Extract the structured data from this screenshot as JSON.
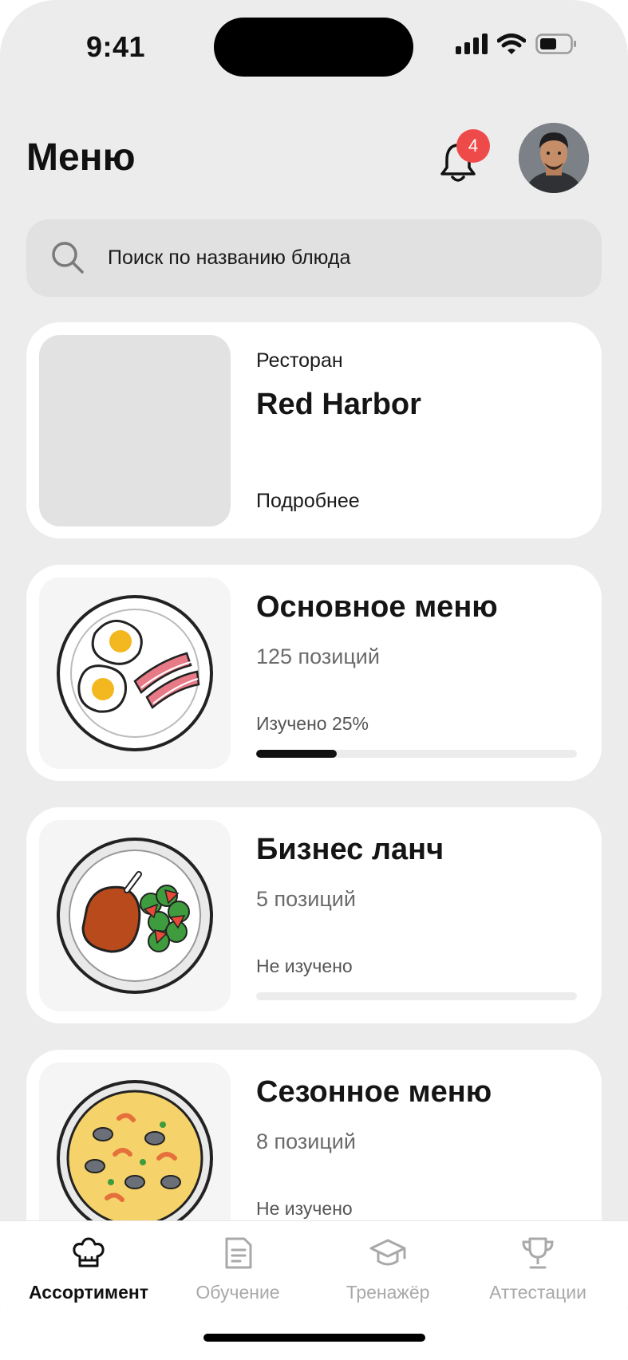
{
  "status_bar": {
    "time": "9:41"
  },
  "header": {
    "title": "Меню",
    "notifications_count": "4"
  },
  "search": {
    "placeholder": "Поиск по названию блюда"
  },
  "restaurant_card": {
    "label": "Ресторан",
    "name": "Red Harbor",
    "details_link": "Подробнее"
  },
  "menus": [
    {
      "title": "Основное меню",
      "count": "125 позиций",
      "status": "Изучено 25%",
      "progress": 0.25,
      "image": "eggs-and-bacon-plate"
    },
    {
      "title": "Бизнес ланч",
      "count": "5 позиций",
      "status": "Не изучено",
      "progress": 0,
      "image": "chicken-leg-with-salad-plate"
    },
    {
      "title": "Сезонное меню",
      "count": "8 позиций",
      "status": "Не изучено",
      "progress": 0,
      "image": "seafood-paella-plate"
    }
  ],
  "tabs": [
    {
      "label": "Ассортимент",
      "icon": "chef-hat-icon",
      "active": true
    },
    {
      "label": "Обучение",
      "icon": "document-icon",
      "active": false
    },
    {
      "label": "Тренажёр",
      "icon": "graduation-cap-icon",
      "active": false
    },
    {
      "label": "Аттестации",
      "icon": "trophy-icon",
      "active": false
    }
  ],
  "colors": {
    "background": "#ececec",
    "badge": "#ef4a4a",
    "progress_fill": "#111111",
    "progress_track": "#ececec"
  }
}
